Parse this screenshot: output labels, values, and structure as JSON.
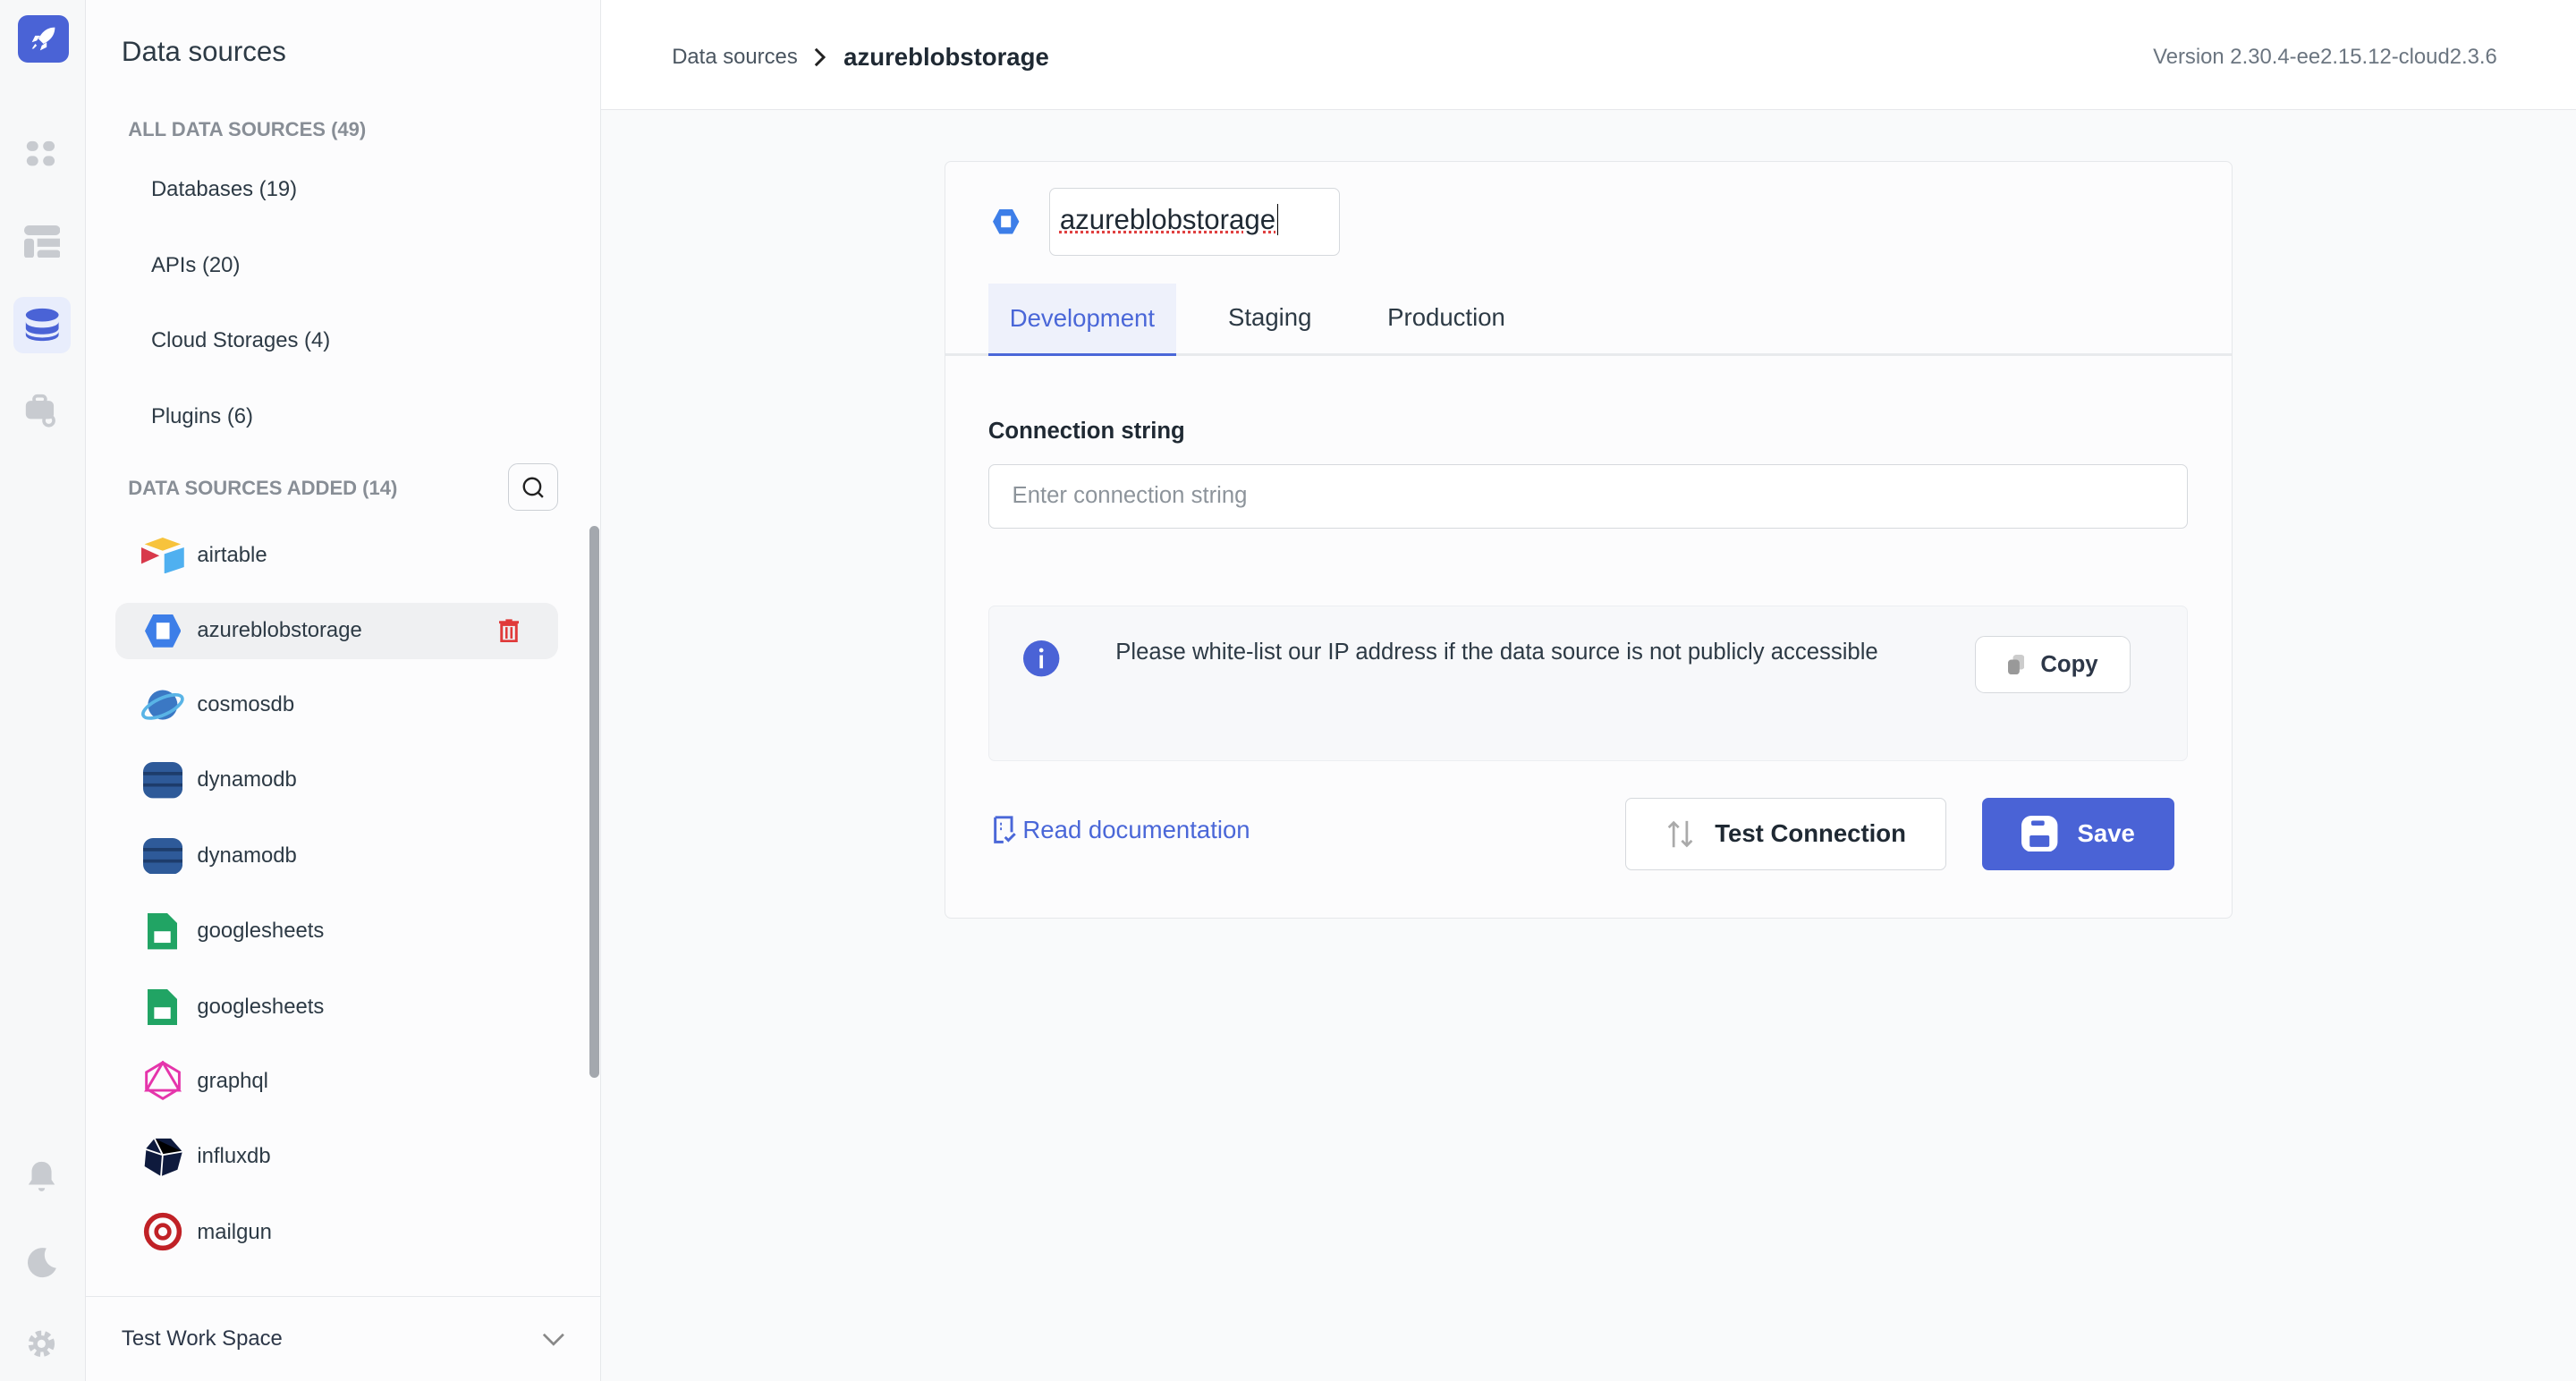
{
  "sidebar": {
    "title": "Data sources",
    "all_header": "ALL DATA SOURCES (49)",
    "categories": [
      "Databases (19)",
      "APIs (20)",
      "Cloud Storages (4)",
      "Plugins (6)"
    ],
    "added_header": "DATA SOURCES ADDED (14)",
    "items": [
      "airtable",
      "azureblobstorage",
      "cosmosdb",
      "dynamodb",
      "dynamodb",
      "googlesheets",
      "googlesheets",
      "graphql",
      "influxdb",
      "mailgun"
    ],
    "workspace": "Test Work Space"
  },
  "header": {
    "breadcrumb_root": "Data sources",
    "breadcrumb_current": "azureblobstorage",
    "version": "Version 2.30.4-ee2.15.12-cloud2.3.6"
  },
  "form": {
    "name": "azureblobstorage",
    "tabs": [
      "Development",
      "Staging",
      "Production"
    ],
    "connection_label": "Connection string",
    "connection_placeholder": "Enter connection string",
    "note": "Please white-list our IP address if the data source is not publicly accessible",
    "copy": "Copy",
    "read_docs": "Read documentation",
    "test": "Test Connection",
    "save": "Save"
  },
  "colors": {
    "accent": "#4a63d6",
    "danger": "#e03a3a"
  }
}
